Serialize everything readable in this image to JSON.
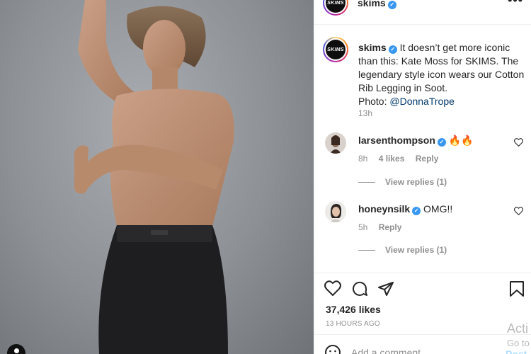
{
  "post": {
    "username": "skims",
    "more_icon": "more-horizontal-icon",
    "avatar_text": "SKIMS",
    "caption": {
      "username": "skims",
      "text_before_link": " It doesn’t get more iconic than this: Kate Moss for SKIMS. The legendary style icon wears our Cotton Rib Legging in Soot.",
      "photo_label": "Photo: ",
      "photo_link": "@DonnaTrope",
      "time": "13h"
    },
    "comments": [
      {
        "username": "larsenthompson",
        "text": " 🔥🔥",
        "time": "8h",
        "likes": "4 likes",
        "reply": "Reply",
        "view_replies": "View replies (1)"
      },
      {
        "username": "honeynsilk",
        "text": " OMG!!",
        "time": "5h",
        "likes": "",
        "reply": "Reply",
        "view_replies": "View replies (1)"
      }
    ],
    "likes": "37,426 likes",
    "post_time": "13 HOURS AGO",
    "add_comment_placeholder": "Add a comment...",
    "post_button": "Post"
  },
  "overlay": {
    "activate_title": "Acti",
    "activate_sub": "Go to"
  },
  "icons": [
    "heart-icon",
    "comment-icon",
    "share-icon",
    "bookmark-icon",
    "emoji-icon",
    "verified-icon"
  ],
  "colors": {
    "verified": "#3897f0",
    "link": "#00376b",
    "muted": "#8e8e8e",
    "post_button": "#b2dffc"
  }
}
